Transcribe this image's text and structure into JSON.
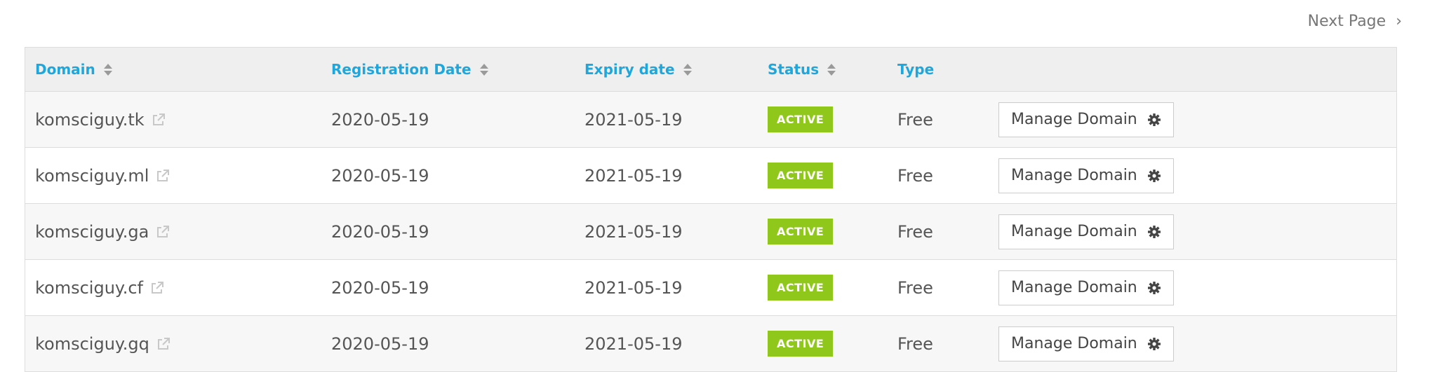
{
  "pagination": {
    "next_label": "Next Page",
    "next_icon": "chevron-right-icon"
  },
  "colors": {
    "header_text": "#1ea7dd",
    "status_active": "#8fc71b",
    "header_bg": "#efefef",
    "row_alt_bg": "#f7f7f7"
  },
  "table": {
    "headers": {
      "domain": "Domain",
      "registration_date": "Registration Date",
      "expiry_date": "Expiry date",
      "status": "Status",
      "type": "Type"
    },
    "rows": [
      {
        "domain": "komsciguy.tk",
        "registration_date": "2020-05-19",
        "expiry_date": "2021-05-19",
        "status": "ACTIVE",
        "type": "Free",
        "action": "Manage Domain"
      },
      {
        "domain": "komsciguy.ml",
        "registration_date": "2020-05-19",
        "expiry_date": "2021-05-19",
        "status": "ACTIVE",
        "type": "Free",
        "action": "Manage Domain"
      },
      {
        "domain": "komsciguy.ga",
        "registration_date": "2020-05-19",
        "expiry_date": "2021-05-19",
        "status": "ACTIVE",
        "type": "Free",
        "action": "Manage Domain"
      },
      {
        "domain": "komsciguy.cf",
        "registration_date": "2020-05-19",
        "expiry_date": "2021-05-19",
        "status": "ACTIVE",
        "type": "Free",
        "action": "Manage Domain"
      },
      {
        "domain": "komsciguy.gq",
        "registration_date": "2020-05-19",
        "expiry_date": "2021-05-19",
        "status": "ACTIVE",
        "type": "Free",
        "action": "Manage Domain"
      }
    ]
  }
}
